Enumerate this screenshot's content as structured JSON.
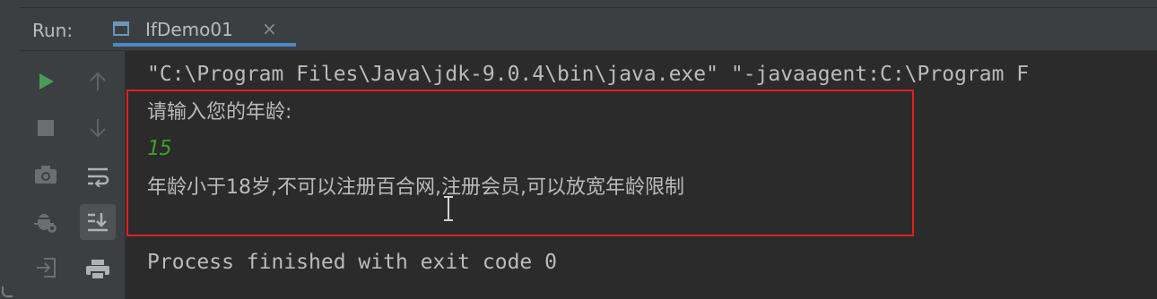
{
  "run_panel": {
    "label": "Run:",
    "tab": {
      "title": "IfDemo01",
      "close_glyph": "×",
      "icon": "console-window-icon"
    }
  },
  "toolbar_left": [
    {
      "icon": "run-icon",
      "color": "#499c54"
    },
    {
      "icon": "stop-icon",
      "color": "#6b6f71"
    },
    {
      "icon": "camera-icon",
      "color": "#6b6f71"
    },
    {
      "icon": "debug-bug-icon",
      "color": "#6b6f71"
    },
    {
      "icon": "exit-login-icon",
      "color": "#6b6f71"
    }
  ],
  "toolbar_right": [
    {
      "icon": "up-arrow-icon"
    },
    {
      "icon": "down-arrow-icon"
    },
    {
      "icon": "soft-wrap-icon"
    },
    {
      "icon": "scroll-to-end-icon",
      "active": true
    },
    {
      "icon": "print-icon"
    }
  ],
  "console": {
    "command": "\"C:\\Program Files\\Java\\jdk-9.0.4\\bin\\java.exe\" \"-javaagent:C:\\Program F",
    "prompt": "请输入您的年龄:",
    "user_input": "15",
    "result": "年龄小于18岁,不可以注册百合网,注册会员,可以放宽年龄限制",
    "exit_message": "Process finished with exit code 0"
  },
  "colors": {
    "background": "#2b2b2b",
    "panel": "#3c3f41",
    "text": "#bbbbbb",
    "input_text": "#3f9c2a",
    "tab_underline": "#4a88c7",
    "highlight_border": "#e0201f",
    "run_icon": "#499c54"
  }
}
